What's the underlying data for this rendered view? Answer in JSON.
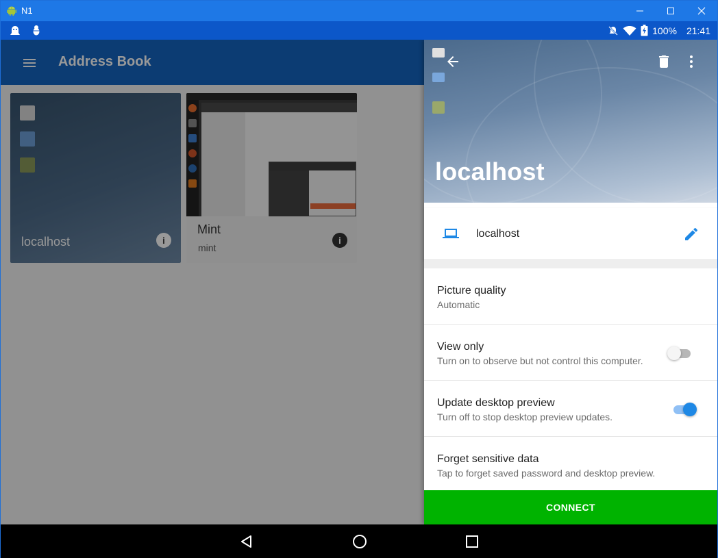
{
  "window": {
    "title": "N1"
  },
  "statusbar": {
    "battery": "100%",
    "time": "21:41"
  },
  "appbar": {
    "title": "Address Book"
  },
  "cards": [
    {
      "label": "localhost",
      "sub": ""
    },
    {
      "label": "Mint",
      "sub": "mint"
    }
  ],
  "detail": {
    "title": "localhost",
    "host_name": "localhost",
    "settings": [
      {
        "title": "Picture quality",
        "subtitle": "Automatic"
      },
      {
        "title": "View only",
        "subtitle": "Turn on to observe but not control this computer.",
        "toggle": false
      },
      {
        "title": "Update desktop preview",
        "subtitle": "Turn off to stop desktop preview updates.",
        "toggle": true
      },
      {
        "title": "Forget sensitive data",
        "subtitle": "Tap to forget saved password and desktop preview."
      }
    ],
    "connect_label": "CONNECT"
  },
  "colors": {
    "titlebar": "#1e78e6",
    "statusbar": "#0c57c9",
    "appbar": "#1565c0",
    "accent": "#1e88e5",
    "connect": "#00b300"
  },
  "icons": [
    "android-icon",
    "minimize-icon",
    "maximize-icon",
    "close-icon",
    "ghost-notification-icon",
    "debug-icon",
    "mute-icon",
    "wifi-icon",
    "battery-icon",
    "menu-icon",
    "info-icon",
    "back-arrow-icon",
    "delete-icon",
    "more-vert-icon",
    "laptop-icon",
    "edit-icon",
    "nav-back-icon",
    "nav-home-icon",
    "nav-recents-icon"
  ]
}
